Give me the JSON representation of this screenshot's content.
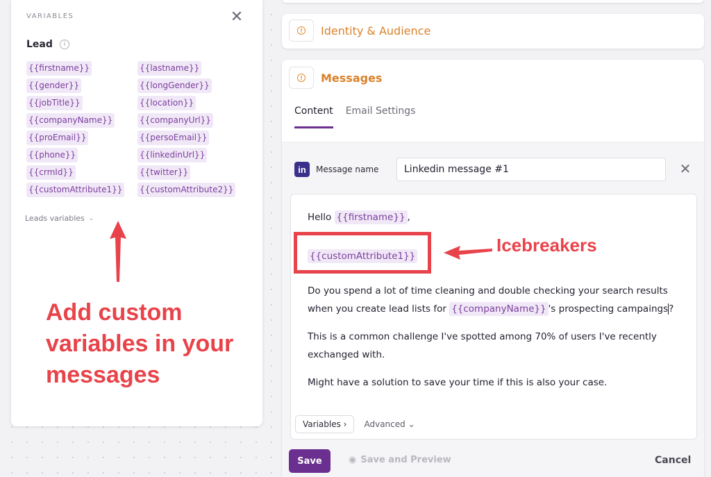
{
  "variables_panel": {
    "title": "VARIABLES",
    "section_title": "Lead",
    "chips": [
      "{{firstname}}",
      "{{lastname}}",
      "{{gender}}",
      "{{longGender}}",
      "{{jobTitle}}",
      "{{location}}",
      "{{companyName}}",
      "{{companyUrl}}",
      "{{proEmail}}",
      "{{persoEmail}}",
      "{{phone}}",
      "{{linkedinUrl}}",
      "{{crmId}}",
      "{{twitter}}",
      "{{customAttribute1}}",
      "{{customAttribute2}}"
    ],
    "leads_variables_label": "Leads variables"
  },
  "annotations": {
    "left": "Add custom variables in your messages",
    "right": "Icebreakers"
  },
  "sections": {
    "identity": "Identity & Audience",
    "messages": "Messages"
  },
  "tabs": [
    "Content",
    "Email Settings"
  ],
  "message": {
    "icon_label": "in",
    "name_label": "Message name",
    "name_value": "Linkedin message #1",
    "hello": "Hello",
    "hello_var": "{{firstname}}",
    "hello_after": ",",
    "custom_var": "{{customAttribute1}}",
    "para1_before": "Do you spend a lot of time cleaning and double checking your search results when you create lead lists for ",
    "para1_var": "{{companyName}}",
    "para1_after_a": "'s prospecting campaings",
    "para1_after_b": "?",
    "para2": "This is a common challenge I've spotted among 70% of users I've recently exchanged with.",
    "para3": "Might have a solution to save your time if this is also your case."
  },
  "footer": {
    "variables": "Variables",
    "advanced": "Advanced",
    "save": "Save",
    "save_preview": "Save and Preview",
    "cancel": "Cancel"
  },
  "colors": {
    "accent": "#6b2f8f",
    "annotation": "#e8434a",
    "section": "#d9822b",
    "chip_bg": "#f1e8f7"
  }
}
